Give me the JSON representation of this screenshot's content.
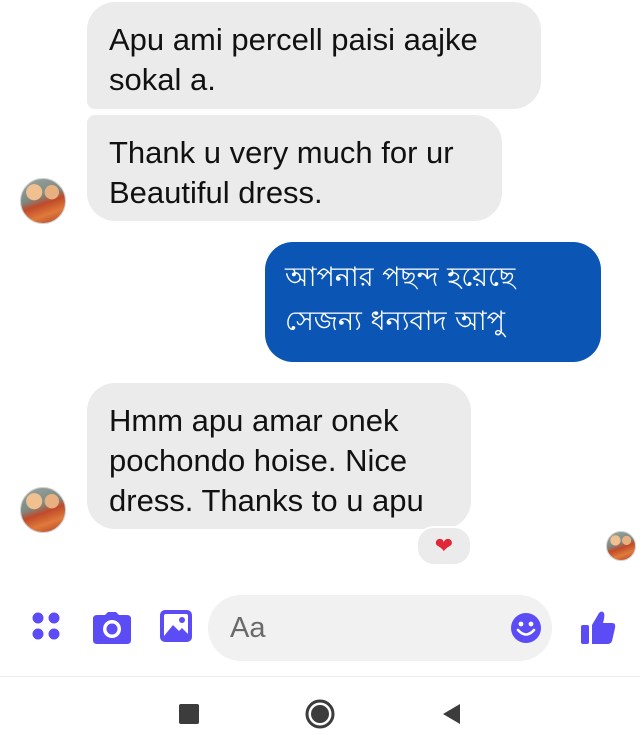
{
  "messages": [
    {
      "direction": "incoming",
      "lines": [
        "Apu ami percell paisi aajke",
        "sokal a."
      ]
    },
    {
      "direction": "incoming",
      "lines": [
        "Thank u very much for ur",
        "Beautiful dress."
      ]
    },
    {
      "direction": "outgoing",
      "lines": [
        "আপনার পছন্দ হয়েছে",
        "সেজন্য ধন্যবাদ আপু"
      ]
    },
    {
      "direction": "incoming",
      "lines": [
        "Hmm apu amar onek",
        "pochondo hoise. Nice",
        "dress. Thanks to u apu"
      ],
      "reaction": "heart-icon"
    }
  ],
  "composer": {
    "placeholder": "Aa",
    "icons": [
      "menu-dots-icon",
      "camera-icon",
      "gallery-icon",
      "emoji-icon",
      "thumbs-up-icon"
    ]
  },
  "navbar": {
    "icons": [
      "recent-apps-icon",
      "home-icon",
      "back-icon"
    ]
  },
  "colors": {
    "accent": "#5b4cf5",
    "outgoing_bubble": "#0b56b5",
    "incoming_bubble": "#ebebeb",
    "reaction_heart": "#e0283a"
  }
}
